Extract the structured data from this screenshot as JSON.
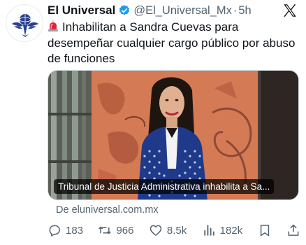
{
  "tweet": {
    "display_name": "El Universal",
    "handle": "@El_Universal_Mx",
    "separator": "·",
    "time": "5h",
    "text": "Inhabilitan a Sandra Cuevas para desempeñar cualquier cargo público por abuso de funciones",
    "card": {
      "caption": "Tribunal de Justicia Administrativa inhabilita a Sa...",
      "source": "De eluniversal.com.mx"
    },
    "actions": {
      "replies": "183",
      "retweets": "966",
      "likes": "8.5k",
      "views": "182k"
    }
  },
  "colors": {
    "verified": "#1d9bf0",
    "text": "#0f1419",
    "muted": "#536471",
    "logo_blue": "#2a3f8f",
    "siren_red": "#e0243a"
  },
  "icons": {
    "avatar": "el-universal-eagle-logo",
    "verified": "verified-badge-icon",
    "brand": "x-logo-icon",
    "emoji": "police-siren-icon",
    "reply": "reply-icon",
    "retweet": "retweet-icon",
    "like": "heart-icon",
    "views": "views-chart-icon",
    "bookmark": "bookmark-icon",
    "share": "share-icon"
  }
}
